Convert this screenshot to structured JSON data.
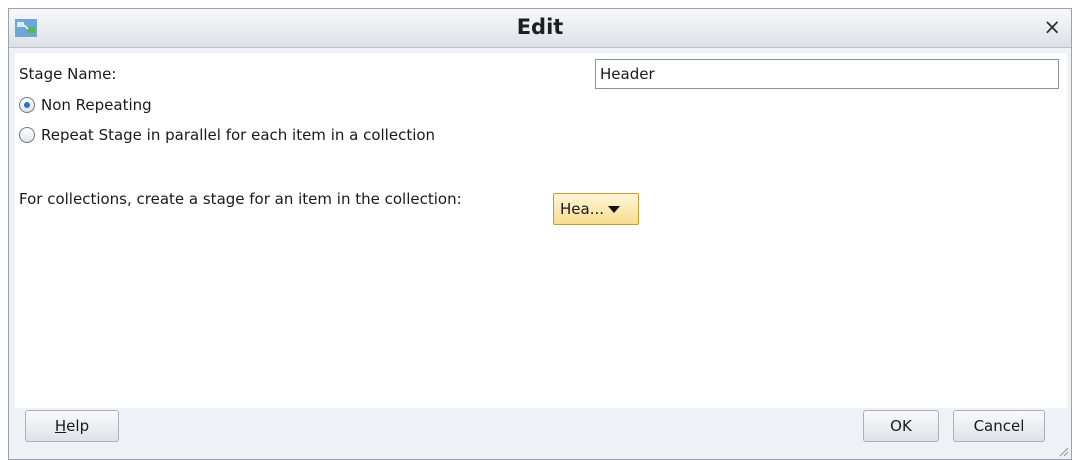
{
  "window": {
    "title": "Edit",
    "close_glyph": "×",
    "app_icon": "app-icon"
  },
  "form": {
    "stage_name_label": "Stage Name:",
    "stage_name_value": "Header",
    "option_non_repeating": "Non Repeating",
    "option_repeat": "Repeat Stage in parallel for each item in a collection",
    "selected_option": "Non Repeating",
    "collection_label": "For collections, create a stage for an item in the collection:",
    "collection_selected": "Hea..."
  },
  "buttons": {
    "help_label": "Help",
    "ok_label": "OK",
    "cancel_label": "Cancel"
  },
  "colors": {
    "dropdown_border": "#c79a2a",
    "radio_selected": "#2f6fc5"
  }
}
